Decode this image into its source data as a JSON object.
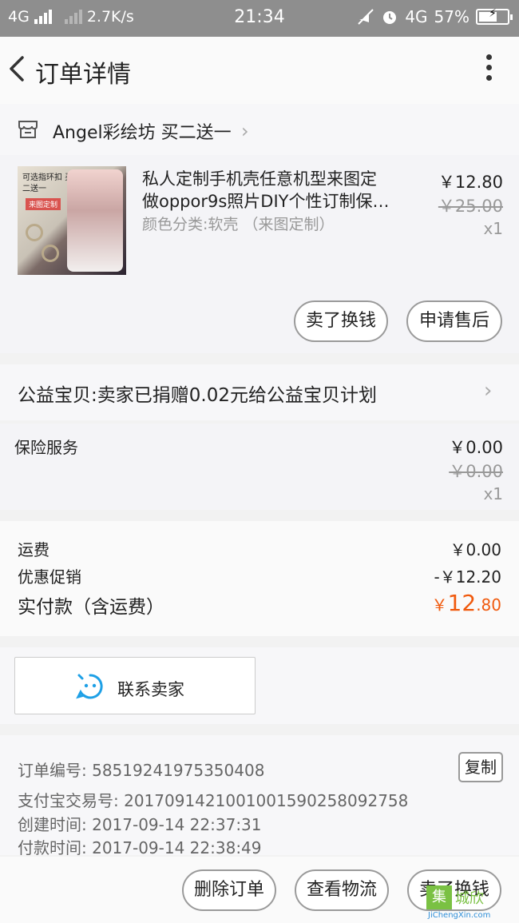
{
  "status_bar": {
    "network_1": "4G",
    "speed": "2.7K/s",
    "time": "21:34",
    "network_2": "4G",
    "battery": "57%",
    "battery_level": 0.57
  },
  "nav": {
    "title": "订单详情"
  },
  "shop": {
    "name": "Angel彩绘坊 买二送一"
  },
  "product": {
    "thumb_text": "可选指环扣 买二送一",
    "thumb_tag": "来图定制",
    "title_line1": "私人定制手机壳任意机型来图定",
    "title_line2": "做oppor9s照片DIY个性订制保…",
    "sku": "颜色分类:软壳 （来图定制）",
    "price": "￥12.80",
    "original_price": "￥25.00",
    "quantity": "x1",
    "sell_exchange_label": "卖了换钱",
    "after_sale_label": "申请售后"
  },
  "charity": {
    "text": "公益宝贝:卖家已捐赠0.02元给公益宝贝计划"
  },
  "insurance": {
    "label": "保险服务",
    "price": "￥0.00",
    "original_price": "￥0.00",
    "quantity": "x1"
  },
  "totals": {
    "shipping_label": "运费",
    "shipping_value": "￥0.00",
    "discount_label": "优惠促销",
    "discount_value": "-￥12.20",
    "paid_label": "实付款（含运费）",
    "paid_currency": "￥",
    "paid_integer": "12",
    "paid_decimal": ".80"
  },
  "contact": {
    "label": "联系卖家"
  },
  "order_info": {
    "order_no": "订单编号: 58519241975350408",
    "copy_label": "复制",
    "alipay_no": "支付宝交易号: 2017091421001001590258092758",
    "created": "创建时间: 2017-09-14 22:37:31",
    "paid": "付款时间: 2017-09-14 22:38:49"
  },
  "bottom_bar": {
    "delete_label": "删除订单",
    "logistics_label": "查看物流",
    "sell_label": "卖了换钱"
  },
  "watermark": {
    "box": "集",
    "text": "城欣",
    "url": "JiChengXin.com"
  },
  "colors": {
    "accent": "#f05a0e",
    "status_bar": "#8e8e8e",
    "watermark_green": "#7ac143",
    "chat_icon": "#1ea0e6"
  }
}
